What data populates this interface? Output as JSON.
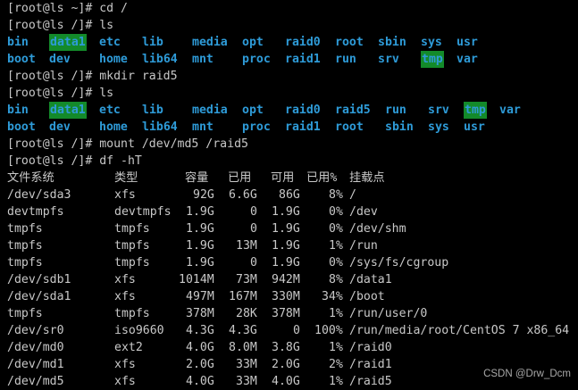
{
  "terminal": {
    "colors": {
      "background": "#000000",
      "text": "#c8c8c8",
      "directory": "#2e9bd8",
      "highlight_bg": "#138a2a"
    },
    "lines": [
      "[root@ls ~]# cd /",
      "[root@ls /]# ls",
      null,
      null,
      "[root@ls /]# mkdir raid5",
      "[root@ls /]# ls",
      null,
      null,
      "[root@ls /]# mount /dev/md5 /raid5",
      "[root@ls /]# df -hT"
    ],
    "ls1": [
      [
        "bin",
        "data1",
        "etc",
        "lib",
        "media",
        "opt",
        "raid0",
        "root",
        "sbin",
        "sys",
        "usr"
      ],
      [
        "boot",
        "dev",
        "home",
        "lib64",
        "mnt",
        "proc",
        "raid1",
        "run",
        "srv",
        "tmp",
        "var"
      ]
    ],
    "ls2": [
      [
        "bin",
        "data1",
        "etc",
        "lib",
        "media",
        "opt",
        "raid0",
        "raid5",
        "run",
        "srv",
        "tmp",
        "var"
      ],
      [
        "boot",
        "dev",
        "home",
        "lib64",
        "mnt",
        "proc",
        "raid1",
        "root",
        "sbin",
        "sys",
        "usr"
      ]
    ],
    "df_header": [
      "文件系统",
      "类型",
      "容量",
      "已用",
      "可用",
      "已用%",
      "挂载点"
    ],
    "df_rows": [
      [
        "/dev/sda3",
        "xfs",
        "92G",
        "6.6G",
        "86G",
        "8%",
        "/"
      ],
      [
        "devtmpfs",
        "devtmpfs",
        "1.9G",
        "0",
        "1.9G",
        "0%",
        "/dev"
      ],
      [
        "tmpfs",
        "tmpfs",
        "1.9G",
        "0",
        "1.9G",
        "0%",
        "/dev/shm"
      ],
      [
        "tmpfs",
        "tmpfs",
        "1.9G",
        "13M",
        "1.9G",
        "1%",
        "/run"
      ],
      [
        "tmpfs",
        "tmpfs",
        "1.9G",
        "0",
        "1.9G",
        "0%",
        "/sys/fs/cgroup"
      ],
      [
        "/dev/sdb1",
        "xfs",
        "1014M",
        "73M",
        "942M",
        "8%",
        "/data1"
      ],
      [
        "/dev/sda1",
        "xfs",
        "497M",
        "167M",
        "330M",
        "34%",
        "/boot"
      ],
      [
        "tmpfs",
        "tmpfs",
        "378M",
        "28K",
        "378M",
        "1%",
        "/run/user/0"
      ],
      [
        "/dev/sr0",
        "iso9660",
        "4.3G",
        "4.3G",
        "0",
        "100%",
        "/run/media/root/CentOS 7 x86_64"
      ],
      [
        "/dev/md0",
        "ext2",
        "4.0G",
        "8.0M",
        "3.8G",
        "1%",
        "/raid0"
      ],
      [
        "/dev/md1",
        "xfs",
        "2.0G",
        "33M",
        "2.0G",
        "2%",
        "/raid1"
      ],
      [
        "/dev/md5",
        "xfs",
        "4.0G",
        "33M",
        "4.0G",
        "1%",
        "/raid5"
      ]
    ],
    "highlighted": [
      "data1",
      "tmp"
    ]
  },
  "watermark": "CSDN @Drw_Dcm"
}
